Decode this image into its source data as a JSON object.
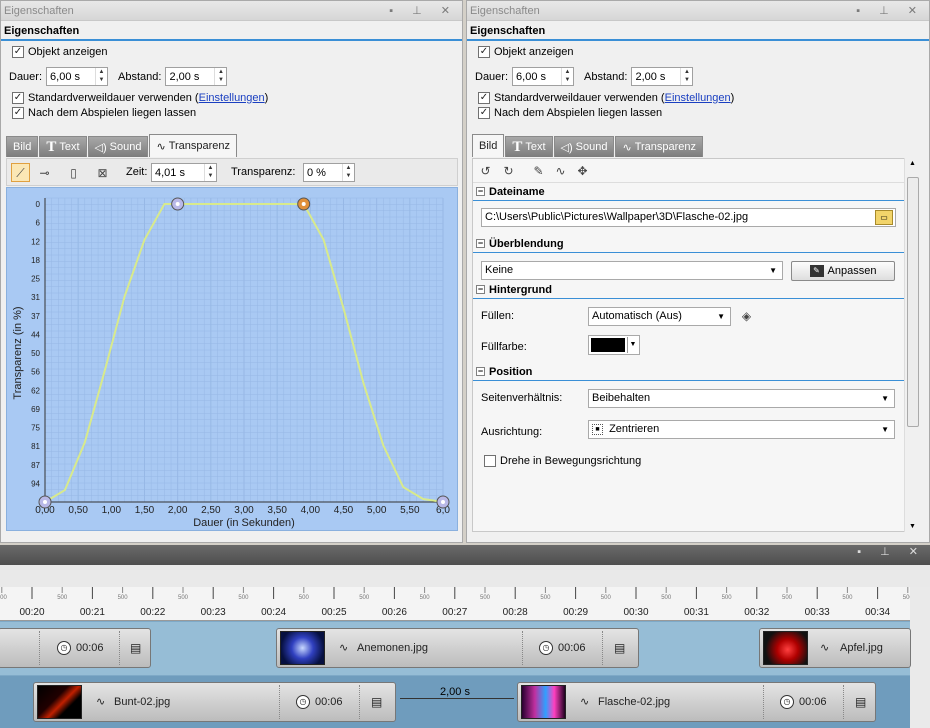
{
  "left_panel": {
    "window_title": "Eigenschaften",
    "header": "Eigenschaften",
    "show_object": "Objekt anzeigen",
    "duration_label": "Dauer:",
    "duration_value": "6,00 s",
    "spacing_label": "Abstand:",
    "spacing_value": "2,00 s",
    "default_duration_text": "Standardverweildauer verwenden (",
    "settings_link": "Einstellungen",
    "default_duration_close": ")",
    "stay_after": "Nach dem Abspielen liegen lassen",
    "tabs": [
      {
        "label": "Bild"
      },
      {
        "label": "Text"
      },
      {
        "label": "Sound"
      },
      {
        "label": "Transparenz"
      }
    ],
    "time_label": "Zeit:",
    "time_value": "4,01 s",
    "transparency_label": "Transparenz:",
    "transparency_value": "0 %"
  },
  "chart_data": {
    "type": "line",
    "xlabel": "Dauer (in Sekunden)",
    "ylabel": "Transparenz (in %)",
    "x_ticks": [
      "0,00",
      "0,50",
      "1,00",
      "1,50",
      "2,00",
      "2,50",
      "3,00",
      "3,50",
      "4,00",
      "4,50",
      "5,00",
      "5,50",
      "6,00"
    ],
    "x_tick_display": [
      "0,00",
      "0,50",
      "1,00",
      "1,50",
      "2,00",
      "2,50",
      "3,00",
      "3,50",
      "4,00",
      "4,50",
      "5,00",
      "5,50",
      "6,0"
    ],
    "y_ticks": [
      "0",
      "6",
      "12",
      "18",
      "25",
      "31",
      "37",
      "44",
      "50",
      "56",
      "62",
      "69",
      "75",
      "81",
      "87",
      "94"
    ],
    "xlim": [
      0,
      6
    ],
    "ylim": [
      0,
      100
    ],
    "y_inverted": true,
    "grid": true,
    "series": [
      {
        "x": [
          0.0,
          0.3,
          0.6,
          0.9,
          1.2,
          1.5,
          1.8,
          2.0,
          3.0,
          3.9,
          4.2,
          4.5,
          4.8,
          5.1,
          5.4,
          5.7,
          6.0
        ],
        "y": [
          100,
          96,
          80,
          56,
          31,
          12,
          0,
          0,
          0,
          0,
          12,
          35,
          60,
          81,
          95,
          99,
          100
        ]
      }
    ],
    "keyframes": [
      {
        "x": 0.0,
        "y": 100,
        "color": "#b9b9e8"
      },
      {
        "x": 2.0,
        "y": 0,
        "color": "#b9b9e8"
      },
      {
        "x": 3.9,
        "y": 0,
        "color": "#e0903a"
      },
      {
        "x": 6.0,
        "y": 100,
        "color": "#b9b9e8"
      }
    ]
  },
  "right_panel": {
    "window_title": "Eigenschaften",
    "header": "Eigenschaften",
    "show_object": "Objekt anzeigen",
    "duration_label": "Dauer:",
    "duration_value": "6,00 s",
    "spacing_label": "Abstand:",
    "spacing_value": "2,00 s",
    "default_duration_text": "Standardverweildauer verwenden (",
    "settings_link": "Einstellungen",
    "default_duration_close": ")",
    "stay_after": "Nach dem Abspielen liegen lassen",
    "tabs": [
      {
        "label": "Bild"
      },
      {
        "label": "Text"
      },
      {
        "label": "Sound"
      },
      {
        "label": "Transparenz"
      }
    ],
    "groups": {
      "filename": "Dateiname",
      "filename_value": "C:\\Users\\Public\\Pictures\\Wallpaper\\3D\\Flasche-02.jpg",
      "blend": "Überblendung",
      "blend_value": "Keine",
      "adjust_button": "Anpassen",
      "background": "Hintergrund",
      "fill_label": "Füllen:",
      "fill_value": "Automatisch (Aus)",
      "fill_color_label": "Füllfarbe:",
      "position": "Position",
      "aspect_label": "Seitenverhältnis:",
      "aspect_value": "Beibehalten",
      "align_label": "Ausrichtung:",
      "align_value": "Zentrieren",
      "rotate_label": "Drehe in Bewegungsrichtung"
    }
  },
  "timeline": {
    "ruler": [
      "00:20",
      "00:21",
      "00:22",
      "00:23",
      "00:24",
      "00:25",
      "00:26",
      "00:27",
      "00:28",
      "00:29",
      "00:30",
      "00:31",
      "00:32",
      "00:33",
      "00:34"
    ],
    "sub_tick": "500",
    "row1": [
      {
        "label": "",
        "duration": "00:06"
      },
      {
        "label": "Anemonen.jpg",
        "duration": "00:06"
      },
      {
        "label": "Apfel.jpg",
        "duration": ""
      }
    ],
    "row2": [
      {
        "label": "Bunt-02.jpg",
        "duration": "00:06"
      },
      {
        "label": "Flasche-02.jpg",
        "duration": "00:06"
      }
    ],
    "gap_label": "2,00 s"
  },
  "colors": {
    "accent": "#3a8fd6",
    "plot_bg": "#a9c9f3",
    "curve": "#d8ea8c"
  }
}
